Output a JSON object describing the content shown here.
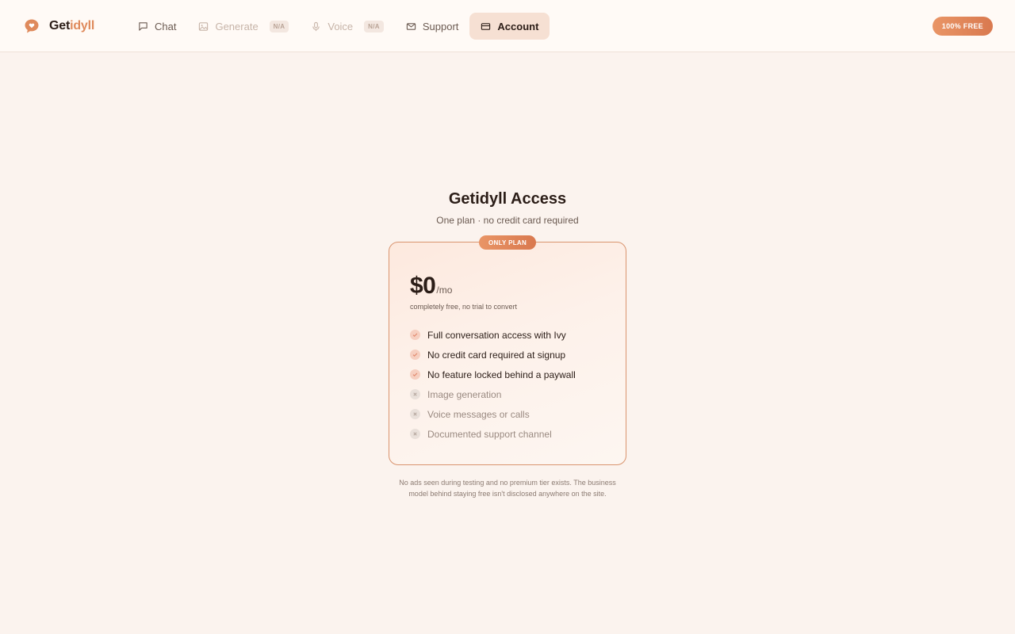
{
  "header": {
    "brand": {
      "part1": "Get",
      "part2": "idyll"
    },
    "nav": [
      {
        "label": "Chat",
        "icon": "chat-bubble-icon",
        "state": "normal"
      },
      {
        "label": "Generate",
        "icon": "image-icon",
        "state": "disabled",
        "badge": "N/A"
      },
      {
        "label": "Voice",
        "icon": "microphone-icon",
        "state": "disabled",
        "badge": "N/A"
      },
      {
        "label": "Support",
        "icon": "mail-icon",
        "state": "normal"
      },
      {
        "label": "Account",
        "icon": "card-icon",
        "state": "active"
      }
    ],
    "pill": "100% FREE"
  },
  "main": {
    "title": "Getidyll Access",
    "subtitle": "One plan · no credit card required",
    "card": {
      "badge": "ONLY PLAN",
      "price": "$0",
      "unit": "/mo",
      "note": "completely free, no trial to convert",
      "features": [
        {
          "text": "Full conversation access with Ivy",
          "included": true
        },
        {
          "text": "No credit card required at signup",
          "included": true
        },
        {
          "text": "No feature locked behind a paywall",
          "included": true
        },
        {
          "text": "Image generation",
          "included": false
        },
        {
          "text": "Voice messages or calls",
          "included": false
        },
        {
          "text": "Documented support channel",
          "included": false
        }
      ]
    },
    "footnote": "No ads seen during testing and no premium tier exists. The business model behind staying free isn't disclosed anywhere on the site."
  },
  "colors": {
    "accent": "#df8a5c",
    "background": "#fbf3ee",
    "header_bg": "#fffaf6",
    "text": "#2b1d17"
  }
}
